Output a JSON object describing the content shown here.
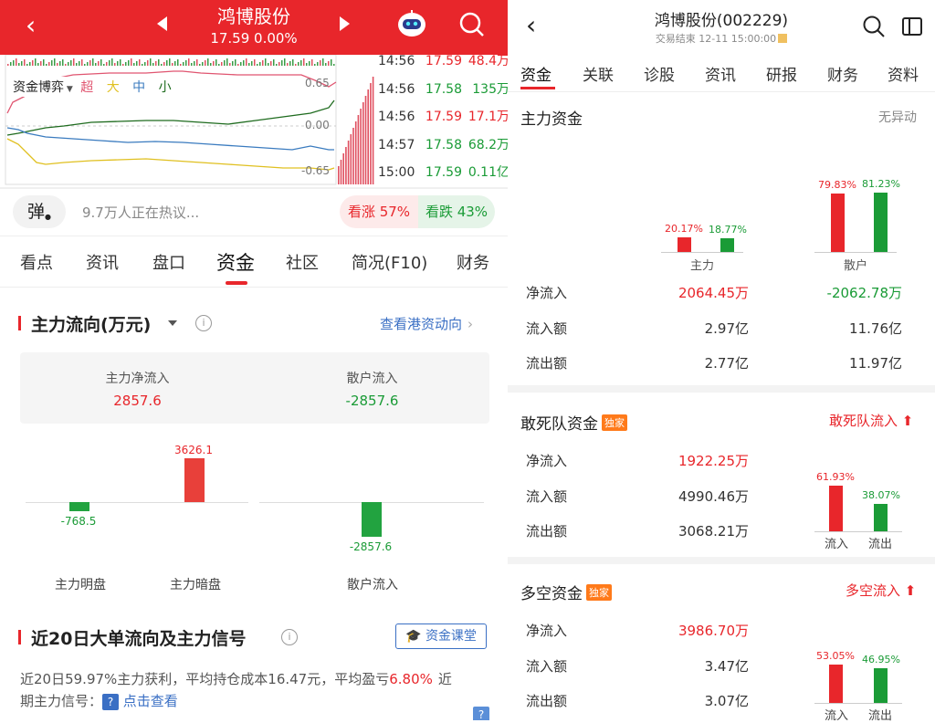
{
  "left": {
    "header": {
      "title": "鸿博股份",
      "price_line": "17.59 0.00%"
    },
    "chart": {
      "selector": "资金博弈",
      "legend": [
        "超",
        "大",
        "中",
        "小"
      ],
      "y_top": "0.65",
      "y_mid": "0.00",
      "y_bot": "-0.65"
    },
    "tape": [
      {
        "time": "14:56",
        "price": "17.59",
        "vol": "48.4万",
        "color": "red"
      },
      {
        "time": "14:56",
        "price": "17.58",
        "vol": "135万",
        "color": "green"
      },
      {
        "time": "14:56",
        "price": "17.59",
        "vol": "17.1万",
        "color": "red"
      },
      {
        "time": "14:57",
        "price": "17.58",
        "vol": "68.2万",
        "color": "green"
      },
      {
        "time": "15:00",
        "price": "17.59",
        "vol": "0.11亿",
        "color": "green"
      }
    ],
    "heat": {
      "bullet": "弹",
      "discussing": "9.7万人正在热议...",
      "up_label": "看涨 57%",
      "down_label": "看跌 43%",
      "up_pct": 57
    },
    "tabs": [
      "看点",
      "资讯",
      "盘口",
      "资金",
      "社区",
      "简况(F10)",
      "财务"
    ],
    "active_tab": "资金",
    "flow": {
      "title": "主力流向(万元)",
      "link": "查看港资动向",
      "net_label": "主力净流入",
      "net_value": "2857.6",
      "retail_label": "散户流入",
      "retail_value": "-2857.6",
      "bars": [
        {
          "label": "主力明盘",
          "value": -768.5,
          "text": "-768.5"
        },
        {
          "label": "主力暗盘",
          "value": 3626.1,
          "text": "3626.1"
        },
        {
          "label": "散户流入",
          "value": -2857.6,
          "text": "-2857.6"
        }
      ]
    },
    "signal": {
      "title": "近20日大单流向及主力信号",
      "course": "资金课堂",
      "desc_a": "近20日59.97%主力获利，平均持仓成本16.47元，平均盈亏",
      "desc_b": "6.80%",
      "desc_c": "近",
      "desc_d": "期主力信号：",
      "link": "点击查看"
    }
  },
  "right": {
    "header": {
      "title": "鸿博股份(002229)",
      "subtitle": "交易结束 12-11 15:00:00"
    },
    "tabs": [
      "资金",
      "关联",
      "诊股",
      "资讯",
      "研报",
      "财务",
      "资料"
    ],
    "active_tab": "资金",
    "main": {
      "title": "主力资金",
      "status": "无异动",
      "groups": [
        {
          "label": "主力",
          "in_pct": 20.17,
          "out_pct": 18.77,
          "in_text": "20.17%",
          "out_text": "18.77%"
        },
        {
          "label": "散户",
          "in_pct": 79.83,
          "out_pct": 81.23,
          "in_text": "79.83%",
          "out_text": "81.23%"
        }
      ],
      "rows": [
        {
          "label": "净流入",
          "v1": "2064.45万",
          "v2": "-2062.78万"
        },
        {
          "label": "流入额",
          "v1": "2.97亿",
          "v2": "11.76亿"
        },
        {
          "label": "流出额",
          "v1": "2.77亿",
          "v2": "11.97亿"
        }
      ]
    },
    "dare": {
      "title": "敢死队资金",
      "badge": "独家",
      "link": "敢死队流入",
      "rows": [
        {
          "label": "净流入",
          "v": "1922.25万"
        },
        {
          "label": "流入额",
          "v": "4990.46万"
        },
        {
          "label": "流出额",
          "v": "3068.21万"
        }
      ],
      "in_pct": 61.93,
      "out_pct": 38.07,
      "in_text": "61.93%",
      "out_text": "38.07%",
      "in_label": "流入",
      "out_label": "流出"
    },
    "longshort": {
      "title": "多空资金",
      "badge": "独家",
      "link": "多空流入",
      "rows": [
        {
          "label": "净流入",
          "v": "3986.70万"
        },
        {
          "label": "流入额",
          "v": "3.47亿"
        },
        {
          "label": "流出额",
          "v": "3.07亿"
        }
      ],
      "in_pct": 53.05,
      "out_pct": 46.95,
      "in_text": "53.05%",
      "out_text": "46.95%",
      "in_label": "流入",
      "out_label": "流出"
    }
  },
  "colors": {
    "red": "#e8262b",
    "green": "#1a9b36",
    "header": "#e8262b"
  }
}
